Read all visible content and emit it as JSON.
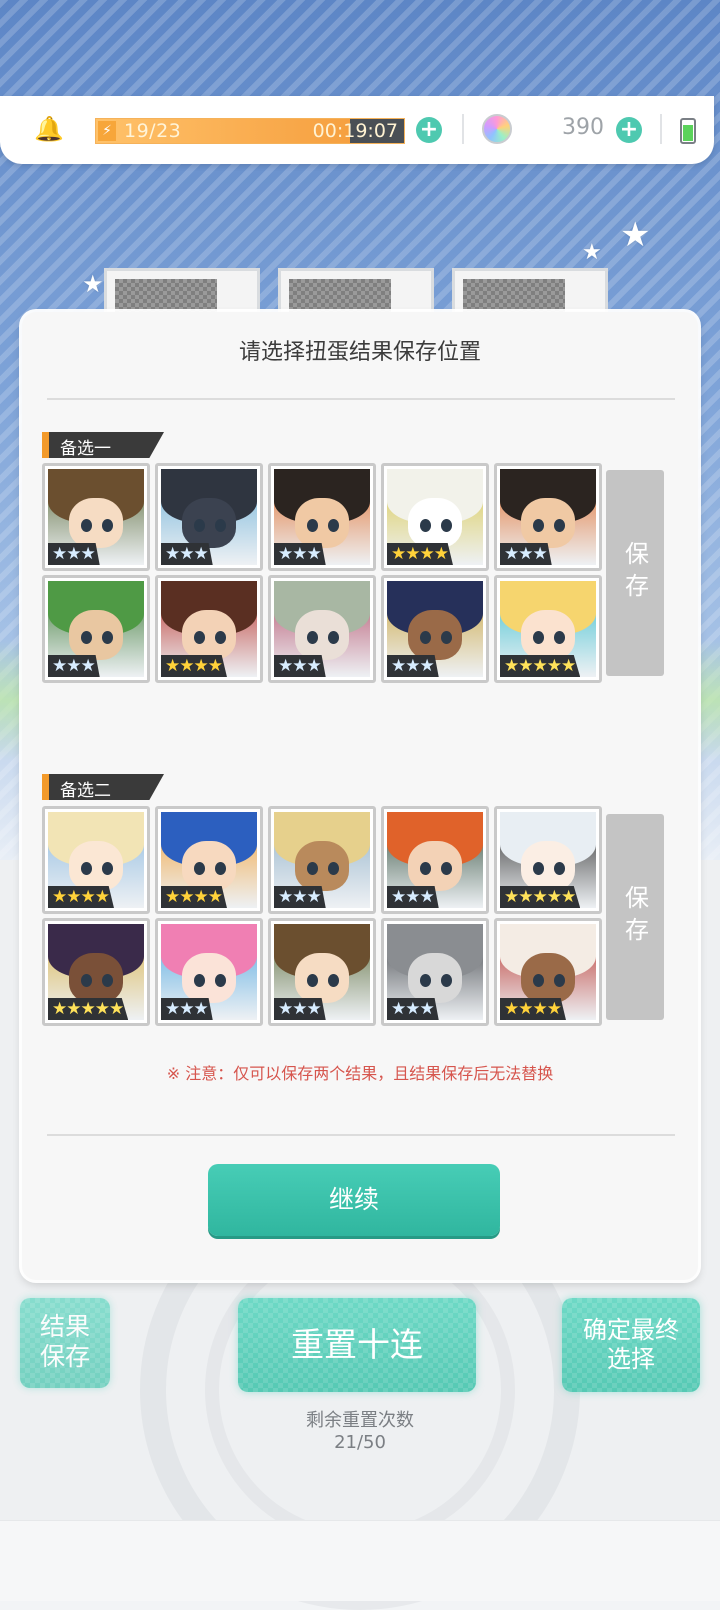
{
  "status_bar": {
    "stamina": "19/23",
    "stamina_fraction": 0.826,
    "timer": "00:19:07",
    "gems": "390"
  },
  "dialog": {
    "title": "请选择扭蛋结果保存位置",
    "save_label": "保存",
    "notice": "※ 注意：仅可以保存两个结果，且结果保存后无法替换",
    "continue_label": "继续",
    "sections": [
      {
        "label": "备选一",
        "cards": [
          {
            "stars": 3,
            "hair": "#6b4f2f",
            "skin": "#f6dcc3",
            "accent": "#5a6b3a"
          },
          {
            "stars": 3,
            "hair": "#2f3540",
            "skin": "#3b4250",
            "accent": "#6fb2d8"
          },
          {
            "stars": 3,
            "hair": "#2b2420",
            "skin": "#f0c9a4",
            "accent": "#e07030"
          },
          {
            "stars": 4,
            "hair": "#f2f2ea",
            "skin": "#ffffff",
            "accent": "#d9c84a"
          },
          {
            "stars": 3,
            "hair": "#2b2420",
            "skin": "#f0c9a4",
            "accent": "#e07030"
          },
          {
            "stars": 3,
            "hair": "#4f9a45",
            "skin": "#e9c7a1",
            "accent": "#3d7a36"
          },
          {
            "stars": 4,
            "hair": "#5a2f22",
            "skin": "#f3d2b6",
            "accent": "#b8302a"
          },
          {
            "stars": 3,
            "hair": "#a8b7a3",
            "skin": "#eadfd7",
            "accent": "#b24a66"
          },
          {
            "stars": 3,
            "hair": "#26305a",
            "skin": "#9a6a48",
            "accent": "#c9a23a"
          },
          {
            "stars": 5,
            "hair": "#f6d56e",
            "skin": "#fbe2cf",
            "accent": "#3bbfcf"
          }
        ]
      },
      {
        "label": "备选二",
        "cards": [
          {
            "stars": 4,
            "hair": "#f2e4b5",
            "skin": "#fbe7d4",
            "accent": "#8ab8df"
          },
          {
            "stars": 4,
            "hair": "#2c5fbf",
            "skin": "#f7d9bf",
            "accent": "#f1a23a"
          },
          {
            "stars": 3,
            "hair": "#e6d08c",
            "skin": "#b98a5c",
            "accent": "#8fb0c8"
          },
          {
            "stars": 3,
            "hair": "#e0622a",
            "skin": "#f3d2b6",
            "accent": "#2f4c3a"
          },
          {
            "stars": 5,
            "hair": "#e8eef3",
            "skin": "#fbeee4",
            "accent": "#2a2a2a"
          },
          {
            "stars": 5,
            "hair": "#3a2a4a",
            "skin": "#7a5038",
            "accent": "#d8b24a"
          },
          {
            "stars": 3,
            "hair": "#f07fb3",
            "skin": "#fbe3d8",
            "accent": "#4fa7e0"
          },
          {
            "stars": 3,
            "hair": "#6b4f2f",
            "skin": "#f6dcc3",
            "accent": "#5a6b3a"
          },
          {
            "stars": 3,
            "hair": "#8a8d91",
            "skin": "#d8d8d8",
            "accent": "#3a3d42"
          },
          {
            "stars": 4,
            "hair": "#f4ece4",
            "skin": "#9a6a48",
            "accent": "#b8302a"
          }
        ]
      }
    ]
  },
  "bottom": {
    "save_result_label": "结果保存",
    "reset_label": "重置十连",
    "confirm_label": "确定最终选择",
    "remaining_label": "剩余重置次数",
    "remaining_count": "21/50"
  },
  "colors": {
    "accent": "#3ebfa9",
    "notice": "#d6554d",
    "save_button": "#c4c4c4"
  }
}
